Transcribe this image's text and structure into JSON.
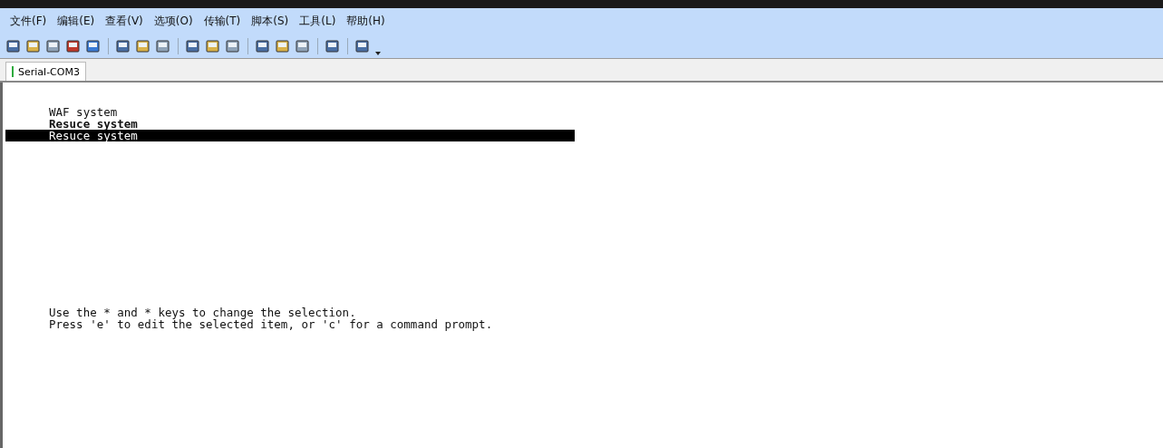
{
  "menu": [
    "文件(F)",
    "编辑(E)",
    "查看(V)",
    "选项(O)",
    "传输(T)",
    "脚本(S)",
    "工具(L)",
    "帮助(H)"
  ],
  "tabs": [
    {
      "label": "Serial-COM3",
      "selected": true
    }
  ],
  "terminal": {
    "entries": [
      {
        "label": "WAF system",
        "kind": "normal"
      },
      {
        "label": "Resuce system",
        "kind": "bold"
      },
      {
        "label": "Resuce system",
        "kind": "selected"
      }
    ],
    "help": [
      "Use the * and * keys to change the selection.",
      "Press 'e' to edit the selected item, or 'c' for a command prompt."
    ]
  }
}
